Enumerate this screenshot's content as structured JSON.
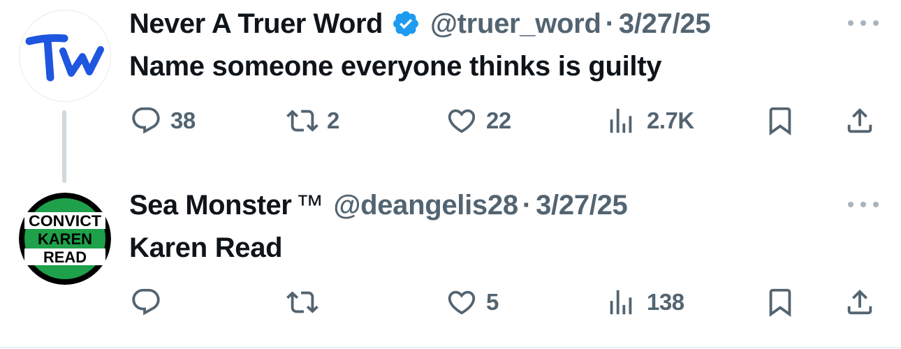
{
  "colors": {
    "text": "#0f1419",
    "muted": "#536471",
    "verified_blue": "#1d9bf0",
    "thread_line": "#cfd9de",
    "avatar_green": "#1ea14a"
  },
  "tweets": [
    {
      "author": {
        "name": "Never A Truer Word",
        "verified": true,
        "handle": "@truer_word",
        "avatar": {
          "type": "logo",
          "text": "Tw",
          "color": "#1f56e0"
        }
      },
      "separator": "·",
      "date": "3/27/25",
      "text": "Name someone everyone thinks is guilty",
      "stats": {
        "replies": "38",
        "retweets": "2",
        "likes": "22",
        "views": "2.7K"
      },
      "icons": [
        "reply-icon",
        "retweet-icon",
        "like-icon",
        "views-icon",
        "bookmark-icon",
        "share-icon",
        "more-icon"
      ]
    },
    {
      "author": {
        "name": "Sea Monster",
        "name_suffix": "™",
        "verified": false,
        "handle": "@deangelis28",
        "avatar": {
          "type": "badge",
          "lines": [
            "CONVICT",
            "KAREN",
            "READ"
          ]
        }
      },
      "separator": "·",
      "date": "3/27/25",
      "text": "Karen Read",
      "stats": {
        "replies": "",
        "retweets": "",
        "likes": "5",
        "views": "138"
      },
      "icons": [
        "reply-icon",
        "retweet-icon",
        "like-icon",
        "views-icon",
        "bookmark-icon",
        "share-icon",
        "more-icon"
      ]
    }
  ]
}
